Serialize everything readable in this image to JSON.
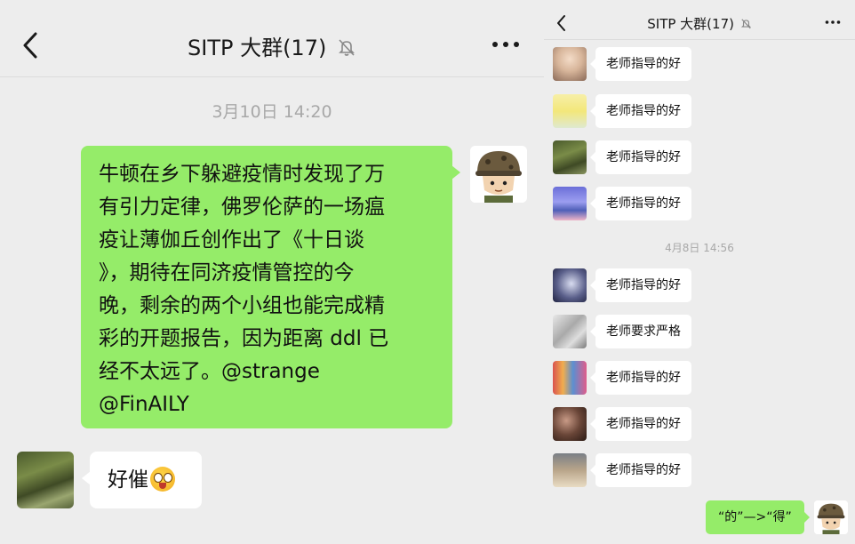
{
  "left": {
    "title": "SITP 大群(17)",
    "timestamp": "3月10日 14:20",
    "my_message_lines": [
      "牛顿在乡下躲避疫情时发现了万",
      "有引力定律，佛罗伦萨的一场瘟",
      "疫让薄伽丘创作出了《十日谈",
      "》，期待在同济疫情管控的今",
      "晚，剩余的两个小组也能完成精",
      "彩的开题报告，因为距离 ddl 已",
      "经不太远了。@strange",
      "@FinAILY"
    ],
    "reply_text": "好催"
  },
  "right": {
    "title": "SITP 大群(17)",
    "timestamp": "4月8日 14:56",
    "messages": [
      {
        "text": "老师指导的好"
      },
      {
        "text": "老师指导的好"
      },
      {
        "text": "老师指导的好"
      },
      {
        "text": "老师指导的好"
      },
      {
        "text": "老师指导的好"
      },
      {
        "text": "老师要求严格"
      },
      {
        "text": "老师指导的好"
      },
      {
        "text": "老师指导的好"
      },
      {
        "text": "老师指导的好"
      }
    ],
    "my_message": "“的”—>“得”"
  },
  "icons": {
    "back": "chevron-left-icon",
    "mute": "bell-off-icon",
    "more": "more-dots-icon",
    "emoji": "tongue-out-emoji-icon"
  },
  "colors": {
    "background": "#ededed",
    "my_bubble": "#95ec69",
    "other_bubble": "#ffffff",
    "timestamp": "#a8a8a8"
  }
}
